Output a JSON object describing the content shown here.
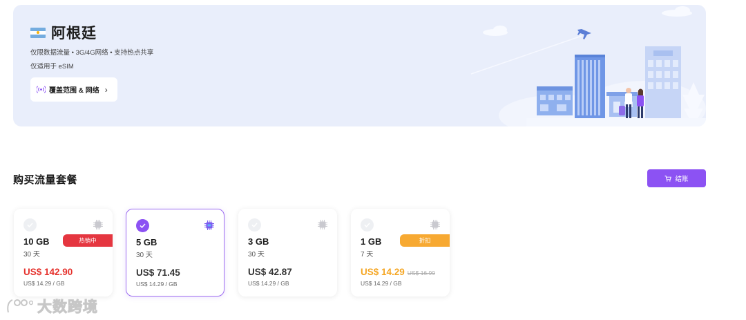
{
  "hero": {
    "country": "阿根廷",
    "features": "仅限数据流量 • 3G/4G网络 • 支持热点共享",
    "esim_note": "仅适用于 eSIM",
    "coverage_label": "覆盖范围 & 网络",
    "flag_icon": "argentina-flag-icon",
    "colors": {
      "banner_bg": "#e9eefb",
      "flag_blue": "#74acdf",
      "flag_sun": "#f6b40e"
    }
  },
  "section": {
    "title": "购买流量套餐",
    "checkout_label": "结账",
    "checkout_icon": "cart-icon",
    "accent": "#8c52f3"
  },
  "plans": [
    {
      "size": "10 GB",
      "days": "30 天",
      "price": "US$ 142.90",
      "old_price": "",
      "unit_price": "US$ 14.29 / GB",
      "badge": "热销中",
      "selected": false
    },
    {
      "size": "5 GB",
      "days": "30 天",
      "price": "US$ 71.45",
      "old_price": "",
      "unit_price": "US$ 14.29 / GB",
      "badge": "",
      "selected": true
    },
    {
      "size": "3 GB",
      "days": "30 天",
      "price": "US$ 42.87",
      "old_price": "",
      "unit_price": "US$ 14.29 / GB",
      "badge": "",
      "selected": false
    },
    {
      "size": "1 GB",
      "days": "7 天",
      "price": "US$ 14.29",
      "old_price": "US$ 16.99",
      "unit_price": "US$ 14.29 / GB",
      "badge": "折扣",
      "selected": false
    }
  ],
  "watermark": {
    "text": "大数跨境"
  }
}
